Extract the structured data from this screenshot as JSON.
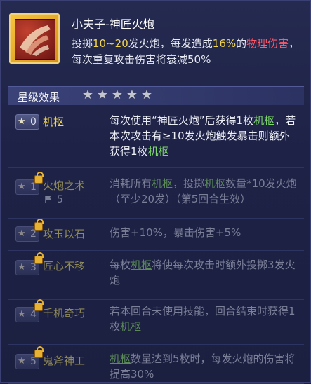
{
  "skill": {
    "icon": "cannon-fire-icon",
    "title": "小夫子-神匠火炮",
    "desc_parts": [
      {
        "text": "投掷",
        "style": "normal"
      },
      {
        "text": "10~20",
        "style": "yellow"
      },
      {
        "text": "发火炮，每发造成",
        "style": "normal"
      },
      {
        "text": "16%",
        "style": "yellow"
      },
      {
        "text": "的",
        "style": "normal"
      },
      {
        "text": "物理伤害",
        "style": "red"
      },
      {
        "text": "，每次重复攻击伤害将衰减50%",
        "style": "normal"
      }
    ]
  },
  "star_section": {
    "title": "星级效果",
    "star_count": 5
  },
  "rows": [
    {
      "level": "0",
      "name": "机枢",
      "locked": false,
      "active": true,
      "desc": [
        {
          "text": "每次使用“神匠火炮”后获得1枚",
          "kw": false
        },
        {
          "text": "机枢",
          "kw": true
        },
        {
          "text": "，若本次攻击有≥10发火炮触发暴击则额外获得1枚",
          "kw": false
        },
        {
          "text": "机枢",
          "kw": true
        }
      ]
    },
    {
      "level": "1",
      "name": "火炮之术",
      "locked": true,
      "active": false,
      "meta": "5",
      "desc": [
        {
          "text": "消耗所有",
          "kw": false
        },
        {
          "text": "机枢",
          "kw": true
        },
        {
          "text": "，投掷",
          "kw": false
        },
        {
          "text": "机枢",
          "kw": true
        },
        {
          "text": "数量*10发火炮（至少20发）（第5回合生效）",
          "kw": false
        }
      ]
    },
    {
      "level": "2",
      "name": "攻玉以石",
      "locked": true,
      "active": false,
      "desc": [
        {
          "text": "伤害+10%，暴击伤害+5%",
          "kw": false
        }
      ]
    },
    {
      "level": "3",
      "name": "匠心不移",
      "locked": true,
      "active": false,
      "desc": [
        {
          "text": "每枚",
          "kw": false
        },
        {
          "text": "机枢",
          "kw": true
        },
        {
          "text": "将使每次攻击时额外投掷3发火炮",
          "kw": false
        }
      ]
    },
    {
      "level": "4",
      "name": "千机奇巧",
      "locked": true,
      "active": false,
      "desc": [
        {
          "text": "若本回合未使用技能，回合结束时获得1枚",
          "kw": false
        },
        {
          "text": "机枢",
          "kw": true
        }
      ]
    },
    {
      "level": "5",
      "name": "鬼斧神工",
      "locked": true,
      "active": false,
      "desc": [
        {
          "text": "机枢",
          "kw": true
        },
        {
          "text": "数量达到5枚时，每发火炮的伤害将提高30%",
          "kw": false
        }
      ]
    }
  ]
}
